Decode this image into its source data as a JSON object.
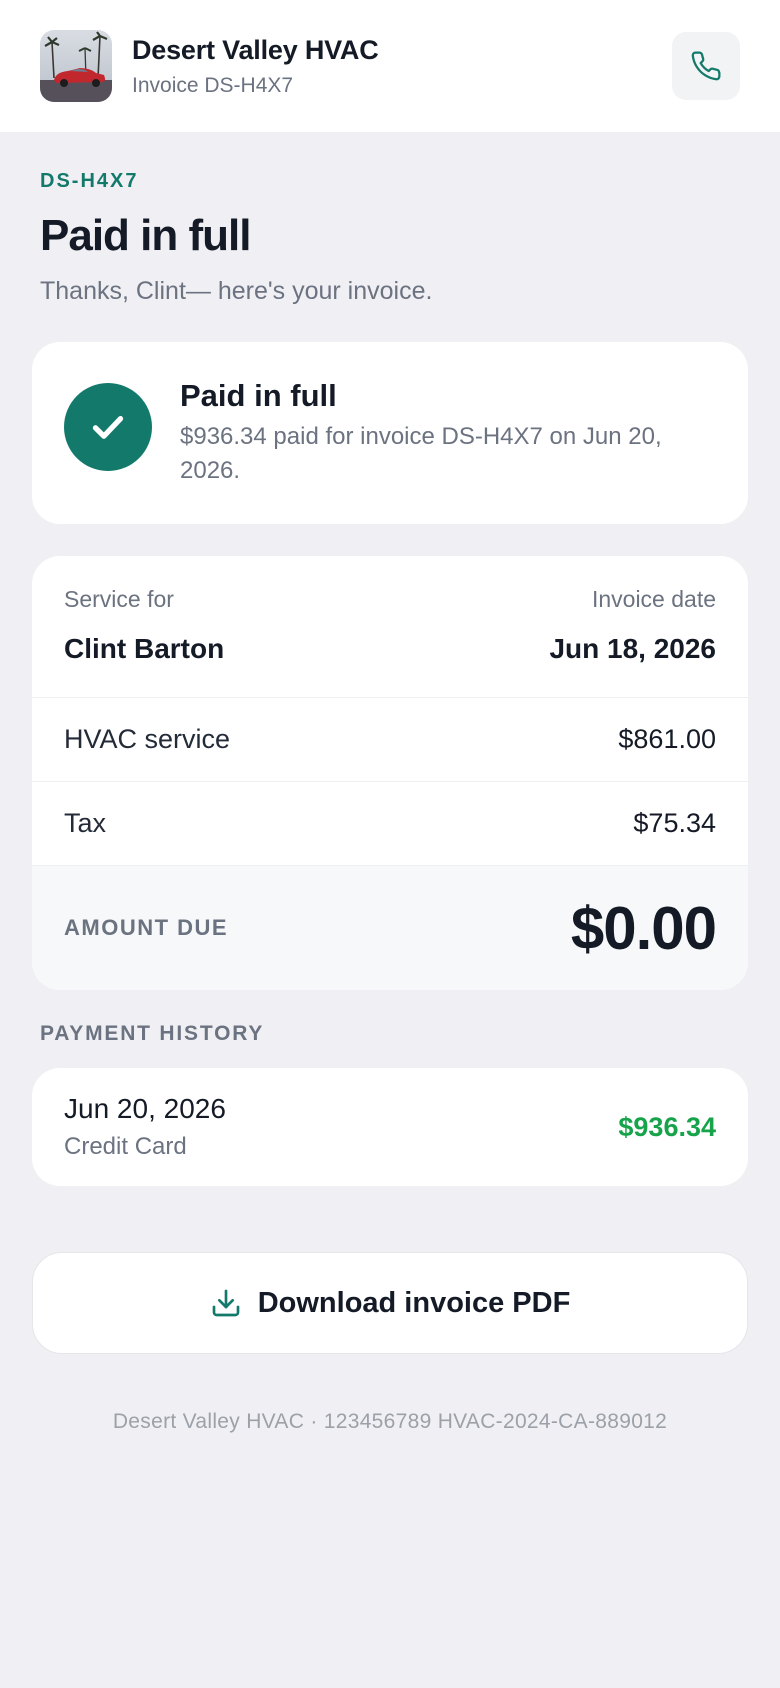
{
  "header": {
    "logo_icon": "business-photo-red-car-palm-trees",
    "business_name": "Desert Valley HVAC",
    "invoice_label": "Invoice DS-H4X7",
    "call_icon": "phone-icon"
  },
  "intro": {
    "invoice_id": "DS-H4X7",
    "title": "Paid in full",
    "subtitle": "Thanks, Clint— here's your invoice."
  },
  "status": {
    "icon": "check-icon",
    "title": "Paid in full",
    "description": "$936.34 paid for invoice DS-H4X7 on Jun 20, 2026."
  },
  "details": {
    "service_for_label": "Service for",
    "service_for_value": "Clint Barton",
    "invoice_date_label": "Invoice date",
    "invoice_date_value": "Jun 18, 2026",
    "line_items": [
      {
        "label": "HVAC service",
        "amount": "$861.00"
      },
      {
        "label": "Tax",
        "amount": "$75.34"
      }
    ],
    "amount_due_label": "AMOUNT DUE",
    "amount_due_value": "$0.00"
  },
  "payment_history": {
    "label": "PAYMENT HISTORY",
    "payments": [
      {
        "date": "Jun 20, 2026",
        "method": "Credit Card",
        "amount": "$936.34"
      }
    ]
  },
  "download": {
    "icon": "download-icon",
    "label": "Download invoice PDF"
  },
  "footer": {
    "text": "Desert Valley HVAC · 123456789 HVAC-2024-CA-889012"
  },
  "colors": {
    "accent": "#137a6b",
    "paid_green": "#16a34a",
    "background": "#f0f0f4"
  }
}
